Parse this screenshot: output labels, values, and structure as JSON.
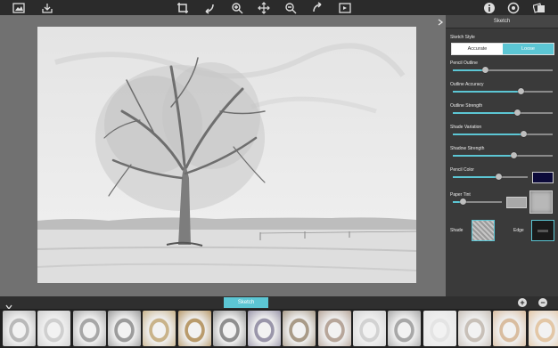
{
  "panel": {
    "title": "Sketch",
    "sketch_style_label": "Sketch Style",
    "style_options": [
      "Accurate",
      "Loose"
    ],
    "style_selected": "Loose",
    "sliders": [
      {
        "key": "pencil_outline",
        "label": "Pencil Outline",
        "value": 0.33
      },
      {
        "key": "outline_accuracy",
        "label": "Outline Accuracy",
        "value": 0.68
      },
      {
        "key": "outline_strength",
        "label": "Outline Strength",
        "value": 0.65
      },
      {
        "key": "shade_variation",
        "label": "Shade Variation",
        "value": 0.71
      },
      {
        "key": "shadow_strength",
        "label": "Shadow Strength",
        "value": 0.61
      }
    ],
    "pencil_color_label": "Pencil Color",
    "pencil_color_value": 0.61,
    "pencil_color": "#0c0a3a",
    "paper_tint_label": "Paper Tint",
    "paper_tint_value": 0.2,
    "shade_label": "Shade",
    "edge_label": "Edge"
  },
  "bottom": {
    "tab_label": "Sketch"
  },
  "filmstrip_count": 16,
  "colors": {
    "accent": "#5cc6d4",
    "toolbar": "#2b2b2b",
    "panel": "#3a3a3a"
  }
}
